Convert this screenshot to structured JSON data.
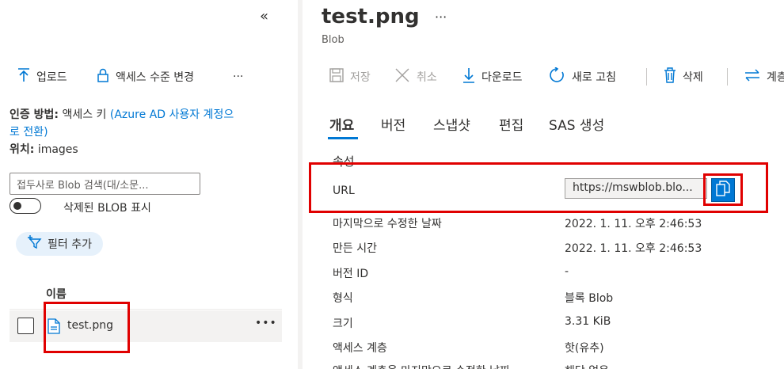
{
  "left": {
    "collapse": "«",
    "toolbar": {
      "upload_icon": "upload-arrow-icon",
      "upload": "업로드",
      "access_icon": "lock-icon",
      "access": "액세스 수준 변경",
      "more": "···"
    },
    "auth": {
      "label": "인증 방법:",
      "value": "액세스 키",
      "link_line1": "(Azure AD 사용자 계정으",
      "link_line2": "로 전환)"
    },
    "location": {
      "label": "위치:",
      "value": "images"
    },
    "search": {
      "placeholder": "접두사로 Blob 검색(대/소문..."
    },
    "toggle_label": "삭제된 BLOB 표시",
    "filter_button": "필터 추가",
    "column_header": "이름",
    "rows": [
      {
        "name": "test.png",
        "more": "•••"
      }
    ]
  },
  "right": {
    "title": "test.png",
    "title_more": "···",
    "subtitle": "Blob",
    "toolbar": {
      "save": "저장",
      "cancel": "취소",
      "download": "다운로드",
      "refresh": "새로 고침",
      "delete": "삭제",
      "change": "계층 변경"
    },
    "tabs": [
      "개요",
      "버전",
      "스냅샷",
      "편집",
      "SAS 생성"
    ],
    "section": "속성",
    "url": {
      "label": "URL",
      "value": "https://mswblob.blo..."
    },
    "properties": [
      {
        "label": "마지막으로 수정한 날짜",
        "value": "2022. 1. 11. 오후 2:46:53"
      },
      {
        "label": "만든 시간",
        "value": "2022. 1. 11. 오후 2:46:53"
      },
      {
        "label": "버전 ID",
        "value": "-"
      },
      {
        "label": "형식",
        "value": "블록 Blob"
      },
      {
        "label": "크기",
        "value": "3.31 KiB"
      },
      {
        "label": "액세스 계층",
        "value": "핫(유추)"
      },
      {
        "label": "액세스 계층을 마지막으로 수정한 날짜",
        "value": "해당 없음"
      }
    ]
  },
  "colors": {
    "accent": "#0078d4",
    "highlight": "#e00000"
  }
}
